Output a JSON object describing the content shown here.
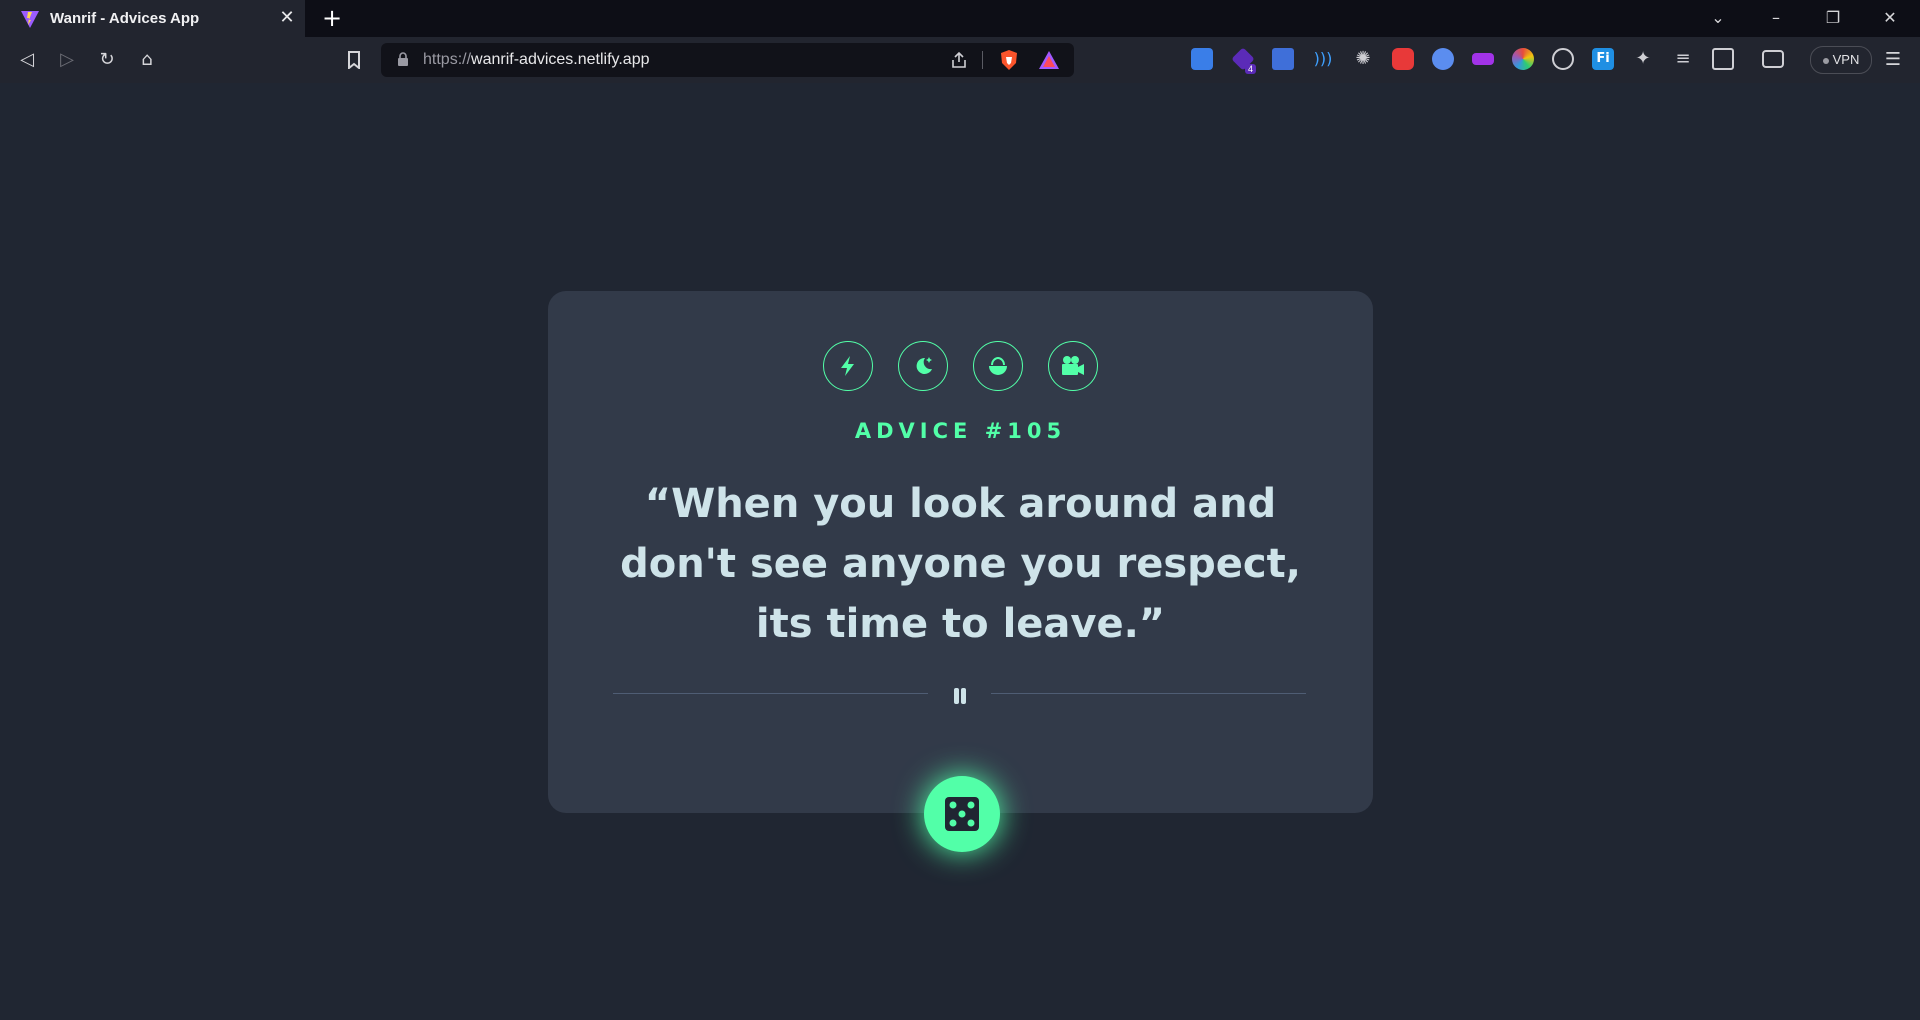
{
  "browser": {
    "tab_title": "Wanrif - Advices App",
    "url_scheme": "https://",
    "url_host": "wanrif-advices.netlify.app",
    "vpn_label": "VPN",
    "extension_badge": "4"
  },
  "card": {
    "icons": [
      "lightning-icon",
      "moon-icon",
      "bowl-icon",
      "video-camera-icon"
    ],
    "advice_label": "ADVICE #105",
    "quote": "“When you look around and don't see anyone you respect, its time to leave.”"
  },
  "colors": {
    "accent": "#52ffa8",
    "card_bg": "#323a49",
    "page_bg": "#202632",
    "quote_text": "#cee3e9"
  }
}
